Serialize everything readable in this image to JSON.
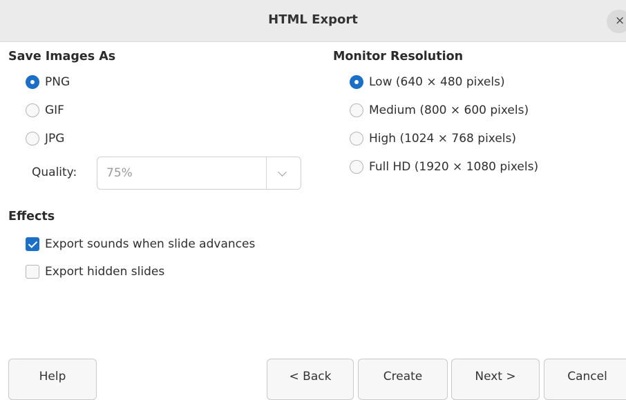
{
  "window": {
    "title": "HTML Export",
    "close_glyph": "×"
  },
  "save_images": {
    "heading": "Save Images As",
    "options": [
      {
        "label": "PNG",
        "checked": true
      },
      {
        "label": "GIF",
        "checked": false
      },
      {
        "label": "JPG",
        "checked": false
      }
    ],
    "quality_label": "Quality:",
    "quality_value": "75%"
  },
  "monitor": {
    "heading": "Monitor Resolution",
    "options": [
      {
        "label": "Low (640 × 480 pixels)",
        "checked": true
      },
      {
        "label": "Medium (800 × 600 pixels)",
        "checked": false
      },
      {
        "label": "High (1024 × 768 pixels)",
        "checked": false
      },
      {
        "label": "Full HD (1920 × 1080 pixels)",
        "checked": false
      }
    ]
  },
  "effects": {
    "heading": "Effects",
    "options": [
      {
        "label": "Export sounds when slide advances",
        "checked": true
      },
      {
        "label": "Export hidden slides",
        "checked": false
      }
    ]
  },
  "buttons": {
    "help": "Help",
    "back": "< Back",
    "create": "Create",
    "next": "Next >",
    "cancel": "Cancel"
  },
  "colors": {
    "accent": "#1b6fc7",
    "titlebar": "#ebebeb"
  }
}
